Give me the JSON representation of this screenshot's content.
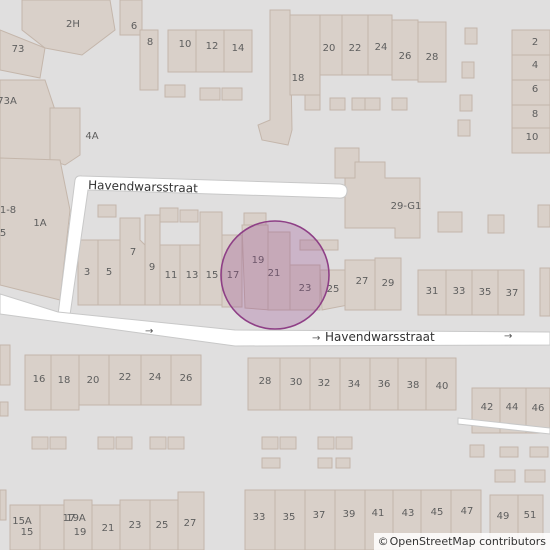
{
  "map": {
    "streets": [
      {
        "name": "Havendwarsstraat",
        "id": "upper"
      },
      {
        "name": "Havendwarsstraat",
        "id": "lower"
      }
    ],
    "one_way_arrows": [
      "→",
      "→",
      "→"
    ],
    "house_numbers": [
      "2H",
      "6",
      "8",
      "10",
      "12",
      "14",
      "20",
      "22",
      "24",
      "26",
      "28",
      "18",
      "73",
      "73A",
      "4A",
      "2",
      "4",
      "6",
      "8",
      "10",
      "1-8",
      "1A",
      "5",
      "29-G1",
      "3",
      "5",
      "7",
      "9",
      "11",
      "13",
      "15",
      "17",
      "19",
      "21",
      "23",
      "25",
      "27",
      "29",
      "31",
      "33",
      "35",
      "37",
      "16",
      "18",
      "20",
      "22",
      "24",
      "26",
      "28",
      "30",
      "32",
      "34",
      "36",
      "38",
      "40",
      "42",
      "44",
      "46",
      "15A",
      "17",
      "19A",
      "15",
      "19",
      "21",
      "23",
      "25",
      "27",
      "33",
      "35",
      "37",
      "39",
      "41",
      "43",
      "45",
      "47",
      "49",
      "51"
    ],
    "marker": {
      "label": "Havendwarsstraat 19-21",
      "color": "#8e3f86"
    }
  },
  "attribution": {
    "symbol": "©",
    "text": "OpenStreetMap contributors"
  }
}
